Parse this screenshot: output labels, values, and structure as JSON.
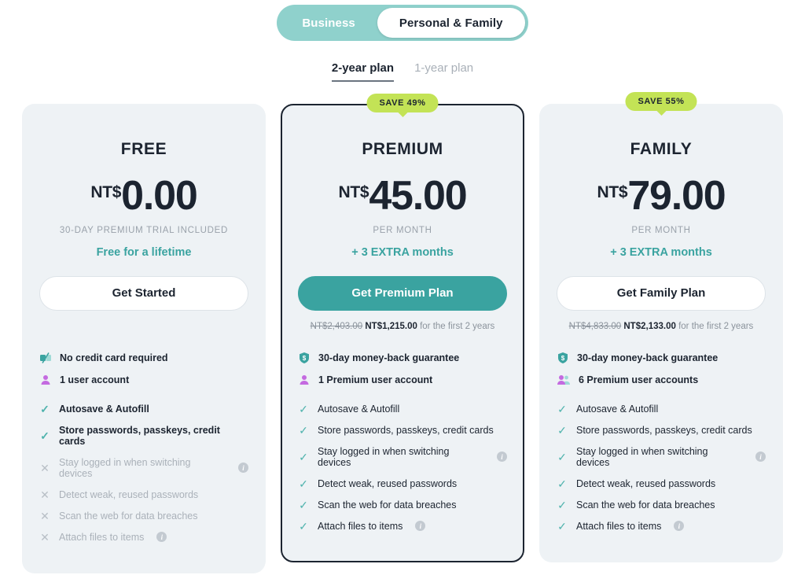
{
  "audience_toggle": {
    "options": [
      {
        "label": "Business",
        "active": false
      },
      {
        "label": "Personal & Family",
        "active": true
      }
    ]
  },
  "term_tabs": {
    "tabs": [
      {
        "label": "2-year plan",
        "active": true
      },
      {
        "label": "1-year plan",
        "active": false
      }
    ]
  },
  "colors": {
    "accent_teal": "#3aa3a0",
    "toggle_teal": "#8fd1cc",
    "badge_green": "#c3e356",
    "card_bg": "#eef2f5",
    "text_dark": "#1c2430",
    "text_muted": "#9aa2ab",
    "check_teal": "#4fb3ad",
    "user_purple": "#c46ae0"
  },
  "plans": [
    {
      "id": "free",
      "badge": null,
      "name": "FREE",
      "currency": "NT$",
      "amount": "0.00",
      "period": "30-DAY PREMIUM TRIAL INCLUDED",
      "promo": "Free for a lifetime",
      "cta": "Get Started",
      "cta_style": "secondary",
      "total_old": "",
      "total_new": "",
      "total_suffix": "",
      "perks": [
        {
          "icon": "no-credit-card-icon",
          "label": "No credit card required"
        },
        {
          "icon": "single-user-icon",
          "label": "1 user account"
        }
      ],
      "features": [
        {
          "label": "Autosave & Autofill",
          "included": true,
          "bold": true,
          "info": false
        },
        {
          "label": "Store passwords, passkeys, credit cards",
          "included": true,
          "bold": true,
          "info": false
        },
        {
          "label": "Stay logged in when switching devices",
          "included": false,
          "bold": false,
          "info": true
        },
        {
          "label": "Detect weak, reused passwords",
          "included": false,
          "bold": false,
          "info": false
        },
        {
          "label": "Scan the web for data breaches",
          "included": false,
          "bold": false,
          "info": false
        },
        {
          "label": "Attach files to items",
          "included": false,
          "bold": false,
          "info": true
        }
      ]
    },
    {
      "id": "premium",
      "badge": "SAVE 49%",
      "name": "PREMIUM",
      "currency": "NT$",
      "amount": "45.00",
      "period": "PER MONTH",
      "promo": "+ 3 EXTRA months",
      "cta": "Get Premium Plan",
      "cta_style": "primary",
      "total_old": "NT$2,403.00",
      "total_new": "NT$1,215.00",
      "total_suffix": "for the first 2 years",
      "perks": [
        {
          "icon": "money-back-guarantee-icon",
          "label": "30-day money-back guarantee"
        },
        {
          "icon": "single-user-icon",
          "label": "1 Premium user account"
        }
      ],
      "features": [
        {
          "label": "Autosave & Autofill",
          "included": true,
          "bold": false,
          "info": false
        },
        {
          "label": "Store passwords, passkeys, credit cards",
          "included": true,
          "bold": false,
          "info": false
        },
        {
          "label": "Stay logged in when switching devices",
          "included": true,
          "bold": false,
          "info": true
        },
        {
          "label": "Detect weak, reused passwords",
          "included": true,
          "bold": false,
          "info": false
        },
        {
          "label": "Scan the web for data breaches",
          "included": true,
          "bold": false,
          "info": false
        },
        {
          "label": "Attach files to items",
          "included": true,
          "bold": false,
          "info": true
        }
      ]
    },
    {
      "id": "family",
      "badge": "SAVE 55%",
      "name": "FAMILY",
      "currency": "NT$",
      "amount": "79.00",
      "period": "PER MONTH",
      "promo": "+ 3 EXTRA months",
      "cta": "Get Family Plan",
      "cta_style": "secondary",
      "total_old": "NT$4,833.00",
      "total_new": "NT$2,133.00",
      "total_suffix": "for the first 2 years",
      "perks": [
        {
          "icon": "money-back-guarantee-icon",
          "label": "30-day money-back guarantee"
        },
        {
          "icon": "multi-user-icon",
          "label": "6 Premium user accounts"
        }
      ],
      "features": [
        {
          "label": "Autosave & Autofill",
          "included": true,
          "bold": false,
          "info": false
        },
        {
          "label": "Store passwords, passkeys, credit cards",
          "included": true,
          "bold": false,
          "info": false
        },
        {
          "label": "Stay logged in when switching devices",
          "included": true,
          "bold": false,
          "info": true
        },
        {
          "label": "Detect weak, reused passwords",
          "included": true,
          "bold": false,
          "info": false
        },
        {
          "label": "Scan the web for data breaches",
          "included": true,
          "bold": false,
          "info": false
        },
        {
          "label": "Attach files to items",
          "included": true,
          "bold": false,
          "info": true
        }
      ]
    }
  ],
  "glyphs": {
    "check": "✓",
    "cross": "✕",
    "info": "i"
  }
}
